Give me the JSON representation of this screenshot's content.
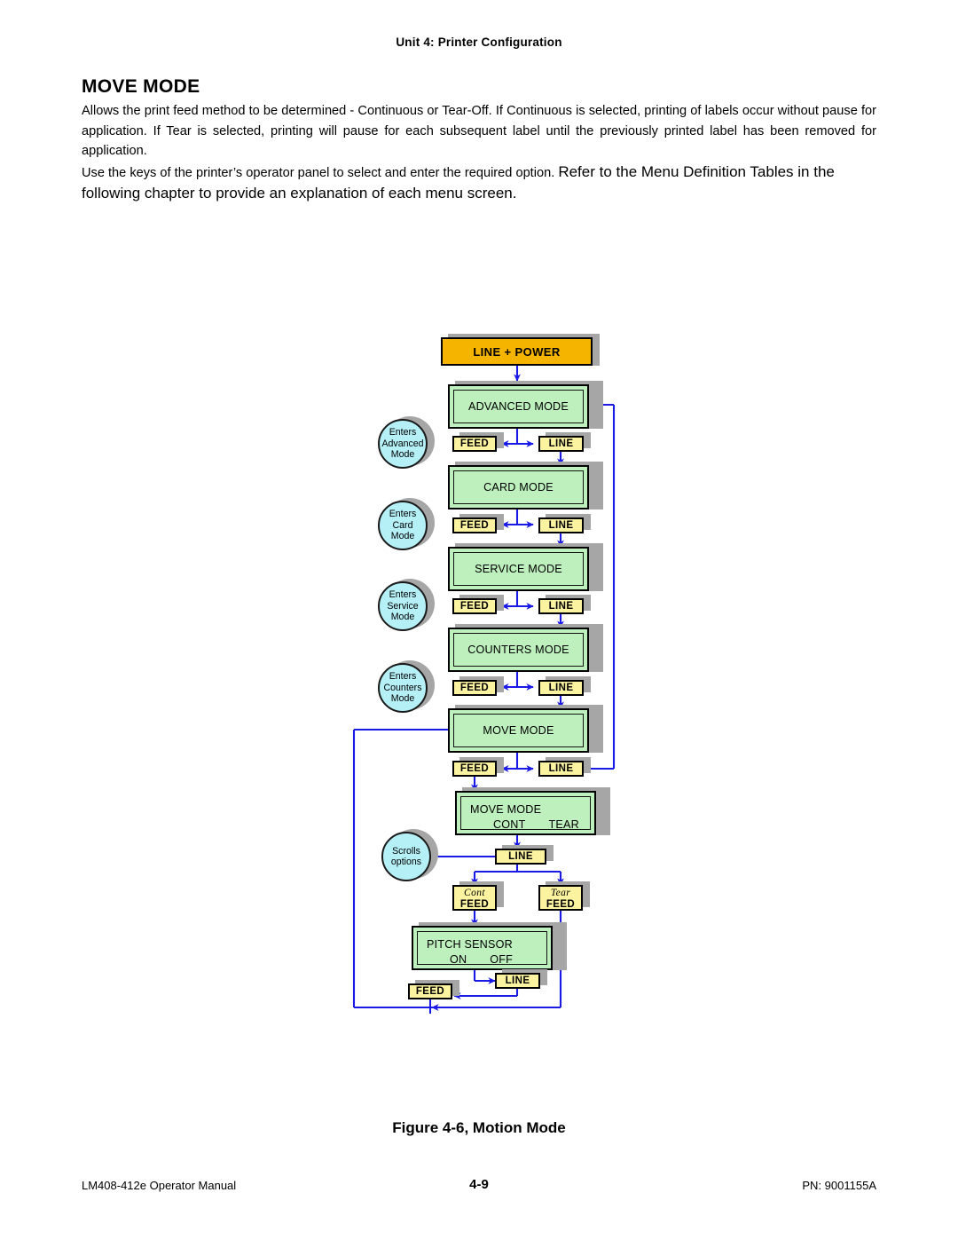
{
  "header": {
    "running_head": "Unit 4:  Printer Configuration"
  },
  "section": {
    "title": "MOVE MODE",
    "paragraph_1": "Allows the print feed method to be determined - Continuous or Tear-Off. If Continuous is selected, printing of labels occur without pause for application. If Tear is selected, printing will pause for each subsequent label until the previously printed label has been removed for application.",
    "paragraph_2_lead": "Use the keys of the printer’s operator panel to select and enter the required option. ",
    "paragraph_2_emph": "Refer to the Menu Definition Tables in the following chapter to provide an explanation of each menu screen."
  },
  "figure": {
    "caption": "Figure 4-6, Motion Mode",
    "start": {
      "label": "LINE + POWER"
    },
    "screens": [
      {
        "id": "advanced-mode",
        "label": "ADVANCED MODE"
      },
      {
        "id": "card-mode",
        "label": "CARD MODE"
      },
      {
        "id": "service-mode",
        "label": "SERVICE MODE"
      },
      {
        "id": "counters-mode",
        "label": "COUNTERS MODE"
      },
      {
        "id": "move-mode",
        "label": "MOVE MODE"
      }
    ],
    "move_mode_options": {
      "line1": "MOVE MODE",
      "opt1": "CONT",
      "opt2": "TEAR"
    },
    "pitch_sensor": {
      "line1": "PITCH SENSOR",
      "opt1": "ON",
      "opt2": "OFF"
    },
    "keys": {
      "feed": "FEED",
      "line": "LINE"
    },
    "rows": [
      {
        "feed": "FEED",
        "line": "LINE"
      },
      {
        "feed": "FEED",
        "line": "LINE"
      },
      {
        "feed": "FEED",
        "line": "LINE"
      },
      {
        "feed": "FEED",
        "line": "LINE"
      },
      {
        "feed": "FEED",
        "line": "LINE"
      }
    ],
    "option_keys": [
      {
        "option": "Cont",
        "key": "FEED"
      },
      {
        "option": "Tear",
        "key": "FEED"
      }
    ],
    "scroll_key": {
      "label": "LINE"
    },
    "bottom_keys": {
      "line": "LINE",
      "feed": "FEED"
    },
    "annotations": [
      {
        "id": "enters-advanced-mode",
        "l1": "Enters",
        "l2": "Advanced",
        "l3": "Mode"
      },
      {
        "id": "enters-card-mode",
        "l1": "Enters",
        "l2": "Card Mode",
        "l3": ""
      },
      {
        "id": "enters-service-mode",
        "l1": "Enters",
        "l2": "Service",
        "l3": "Mode"
      },
      {
        "id": "enters-counters-mode",
        "l1": "Enters",
        "l2": "Counters",
        "l3": "Mode"
      },
      {
        "id": "scrolls-options",
        "l1": "Scrolls",
        "l2": "options",
        "l3": ""
      }
    ],
    "colors": {
      "start_fill": "#f5b400",
      "screen_fill": "#bdf0bd",
      "key_fill": "#fbf3a0",
      "circle_fill": "#b6f0f7",
      "connector": "#1a1ae6",
      "shadow": "#a6a6a6"
    }
  },
  "footer": {
    "left": "LM408-412e Operator Manual",
    "center": "4-9",
    "right": "PN: 9001155A"
  }
}
